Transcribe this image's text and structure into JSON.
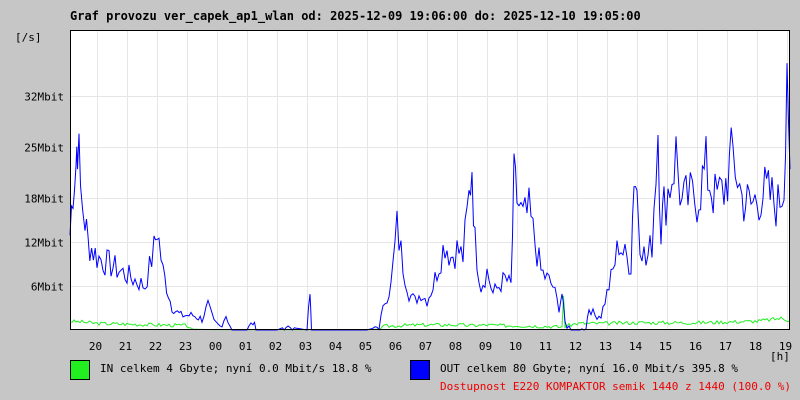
{
  "title": "Graf provozu ver_capek_ap1_wlan od: 2025-12-09 19:06:00 do: 2025-12-10 19:05:00",
  "colors": {
    "in": "#22ee22",
    "out": "#0000ff",
    "availability": "#ee0000",
    "grid": "#e6e6e6"
  },
  "legend": {
    "in_text": "IN celkem 4 Gbyte; nyní   0.0 Mbit/s 18.8 %",
    "out_text": "OUT celkem 80 Gbyte; nyní  16.0 Mbit/s 395.8 %",
    "availability_text": "Dostupnost E220 KOMPAKTOR semik 1440 z 1440 (100.0 %)"
  },
  "chart_data": {
    "type": "line",
    "title": "Graf provozu ver_capek_ap1_wlan od: 2025-12-09 19:06:00 do: 2025-12-10 19:05:00",
    "ylabel": "[/s]",
    "xlabel": "[h]",
    "y_unit": "Mbit/s",
    "ylim": [
      0,
      41
    ],
    "y_ticks": [
      6,
      12,
      18,
      25,
      32
    ],
    "y_tick_labels": [
      "6Mbit",
      "12Mbit",
      "18Mbit",
      "25Mbit",
      "32Mbit"
    ],
    "xlim": [
      19.1,
      43.1
    ],
    "x_ticks": [
      20,
      21,
      22,
      23,
      24,
      25,
      26,
      27,
      28,
      29,
      30,
      31,
      32,
      33,
      34,
      35,
      36,
      37,
      38,
      39,
      40,
      41,
      42,
      43
    ],
    "x_tick_labels": [
      "20",
      "21",
      "22",
      "23",
      "00",
      "01",
      "02",
      "03",
      "04",
      "05",
      "06",
      "07",
      "08",
      "09",
      "10",
      "11",
      "12",
      "13",
      "14",
      "15",
      "16",
      "17",
      "18",
      "19"
    ],
    "grid": true,
    "series": [
      {
        "name": "IN",
        "color": "#22ee22",
        "points": [
          [
            19.1,
            1.2
          ],
          [
            19.5,
            1.1
          ],
          [
            20,
            0.9
          ],
          [
            21,
            0.8
          ],
          [
            22,
            0.7
          ],
          [
            23,
            0.6
          ],
          [
            23.2,
            0.1
          ],
          [
            24,
            0.05
          ],
          [
            25,
            0.05
          ],
          [
            26,
            0.05
          ],
          [
            27,
            0.05
          ],
          [
            28,
            0.05
          ],
          [
            29,
            0.05
          ],
          [
            29.4,
            0.1
          ],
          [
            29.6,
            0.5
          ],
          [
            30,
            0.6
          ],
          [
            31,
            0.7
          ],
          [
            32,
            0.7
          ],
          [
            32.5,
            0.6
          ],
          [
            33,
            0.7
          ],
          [
            33.5,
            0.6
          ],
          [
            34,
            0.6
          ],
          [
            35,
            0.5
          ],
          [
            35.5,
            0.4
          ],
          [
            35.55,
            4.5
          ],
          [
            35.6,
            0.5
          ],
          [
            36,
            0.9
          ],
          [
            37,
            0.9
          ],
          [
            38,
            1.0
          ],
          [
            39,
            1.0
          ],
          [
            40,
            1.0
          ],
          [
            41,
            1.1
          ],
          [
            42,
            1.2
          ],
          [
            42.8,
            1.6
          ],
          [
            43.1,
            1.3
          ]
        ]
      },
      {
        "name": "OUT",
        "color": "#0000ff",
        "points": [
          [
            19.1,
            13
          ],
          [
            19.2,
            20
          ],
          [
            19.3,
            23
          ],
          [
            19.35,
            27
          ],
          [
            19.45,
            19
          ],
          [
            19.6,
            15
          ],
          [
            19.7,
            12
          ],
          [
            20,
            10
          ],
          [
            20.4,
            9
          ],
          [
            20.8,
            8
          ],
          [
            21.2,
            7
          ],
          [
            21.6,
            6
          ],
          [
            21.9,
            11
          ],
          [
            22.0,
            14
          ],
          [
            22.2,
            8
          ],
          [
            22.5,
            3
          ],
          [
            22.8,
            2
          ],
          [
            23.2,
            2
          ],
          [
            23.5,
            1.5
          ],
          [
            23.7,
            3.5
          ],
          [
            23.9,
            1
          ],
          [
            24.1,
            0.5
          ],
          [
            24.3,
            2
          ],
          [
            24.5,
            0
          ],
          [
            25,
            0
          ],
          [
            25.2,
            1
          ],
          [
            25.3,
            0
          ],
          [
            26,
            0
          ],
          [
            26.3,
            0.5
          ],
          [
            27,
            0
          ],
          [
            27.1,
            5
          ],
          [
            27.15,
            0
          ],
          [
            28,
            0
          ],
          [
            29,
            0
          ],
          [
            29.4,
            0.5
          ],
          [
            29.6,
            4
          ],
          [
            29.8,
            6
          ],
          [
            30,
            14
          ],
          [
            30.2,
            9
          ],
          [
            30.4,
            5
          ],
          [
            30.6,
            4
          ],
          [
            30.8,
            5
          ],
          [
            31,
            4
          ],
          [
            31.2,
            6
          ],
          [
            31.4,
            9
          ],
          [
            31.6,
            12
          ],
          [
            31.8,
            10
          ],
          [
            32,
            11
          ],
          [
            32.2,
            10
          ],
          [
            32.4,
            18
          ],
          [
            32.5,
            23
          ],
          [
            32.6,
            12
          ],
          [
            32.8,
            6
          ],
          [
            33,
            8
          ],
          [
            33.2,
            5
          ],
          [
            33.4,
            6
          ],
          [
            33.6,
            7
          ],
          [
            33.8,
            6
          ],
          [
            33.9,
            20
          ],
          [
            34,
            18
          ],
          [
            34.2,
            15
          ],
          [
            34.4,
            16
          ],
          [
            34.6,
            12
          ],
          [
            34.8,
            8
          ],
          [
            35,
            7
          ],
          [
            35.2,
            6
          ],
          [
            35.4,
            3
          ],
          [
            35.5,
            5
          ],
          [
            35.6,
            1
          ],
          [
            35.8,
            0
          ],
          [
            36.1,
            0
          ],
          [
            36.3,
            0.5
          ],
          [
            36.4,
            3
          ],
          [
            36.6,
            2
          ],
          [
            36.8,
            2
          ],
          [
            37,
            5
          ],
          [
            37.2,
            8
          ],
          [
            37.4,
            12
          ],
          [
            37.6,
            10
          ],
          [
            37.8,
            9
          ],
          [
            37.9,
            22
          ],
          [
            38,
            19
          ],
          [
            38.1,
            13
          ],
          [
            38.3,
            9
          ],
          [
            38.5,
            12
          ],
          [
            38.7,
            28
          ],
          [
            38.8,
            14
          ],
          [
            38.9,
            17
          ],
          [
            39.1,
            20
          ],
          [
            39.3,
            24
          ],
          [
            39.5,
            17
          ],
          [
            39.7,
            18
          ],
          [
            40,
            18
          ],
          [
            40.3,
            22
          ],
          [
            40.6,
            18
          ],
          [
            40.9,
            19
          ],
          [
            41.2,
            24
          ],
          [
            41.5,
            18
          ],
          [
            41.8,
            17
          ],
          [
            42.2,
            19
          ],
          [
            42.5,
            18
          ],
          [
            42.7,
            17
          ],
          [
            42.9,
            20
          ],
          [
            43.0,
            39
          ],
          [
            43.1,
            22
          ]
        ]
      }
    ]
  }
}
